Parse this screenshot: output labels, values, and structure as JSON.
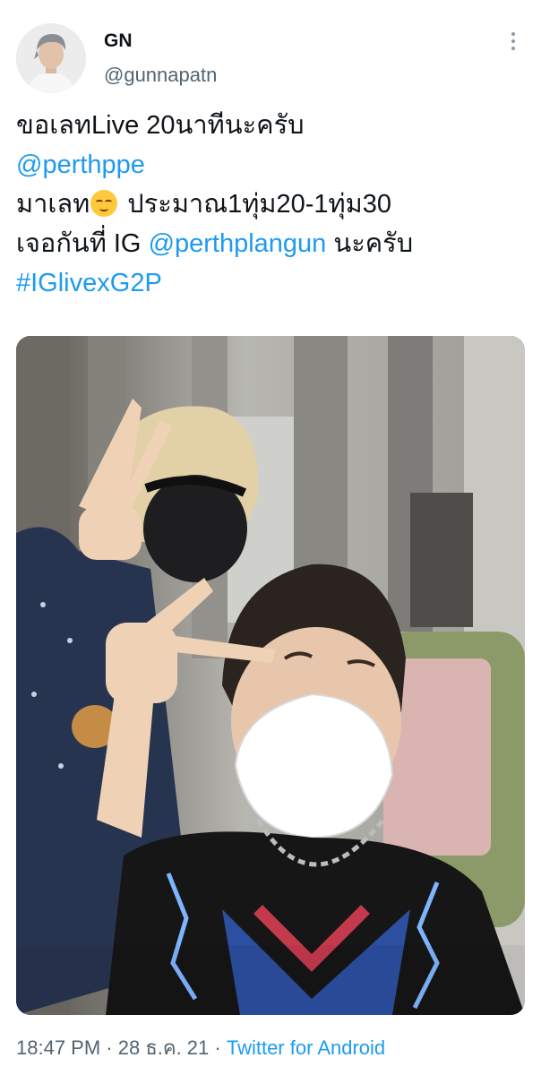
{
  "user": {
    "display_name": "GN",
    "handle": "@gunnapatn"
  },
  "tweet": {
    "line1": "ขอเลทLive 20นาทีนะครับ",
    "mention1": "@perthppe",
    "line3_before_emoji": "มาเลท",
    "emoji": "relieved-face-emoji",
    "line3_after_emoji": " ประมาณ1ทุ่ม20-1ทุ่ม30",
    "line4_before": "เจอกันที่ IG ",
    "mention2": "@perthplangun",
    "line4_after": " นะครับ",
    "hashtag": "#IGlivexG2P"
  },
  "meta": {
    "time": "18:47 PM",
    "dot1": " · ",
    "date": "28 ธ.ค. 21",
    "dot2": " · ",
    "source": "Twitter for Android"
  },
  "colors": {
    "link": "#1d9bf0",
    "text": "#0f1419",
    "muted": "#536471"
  }
}
